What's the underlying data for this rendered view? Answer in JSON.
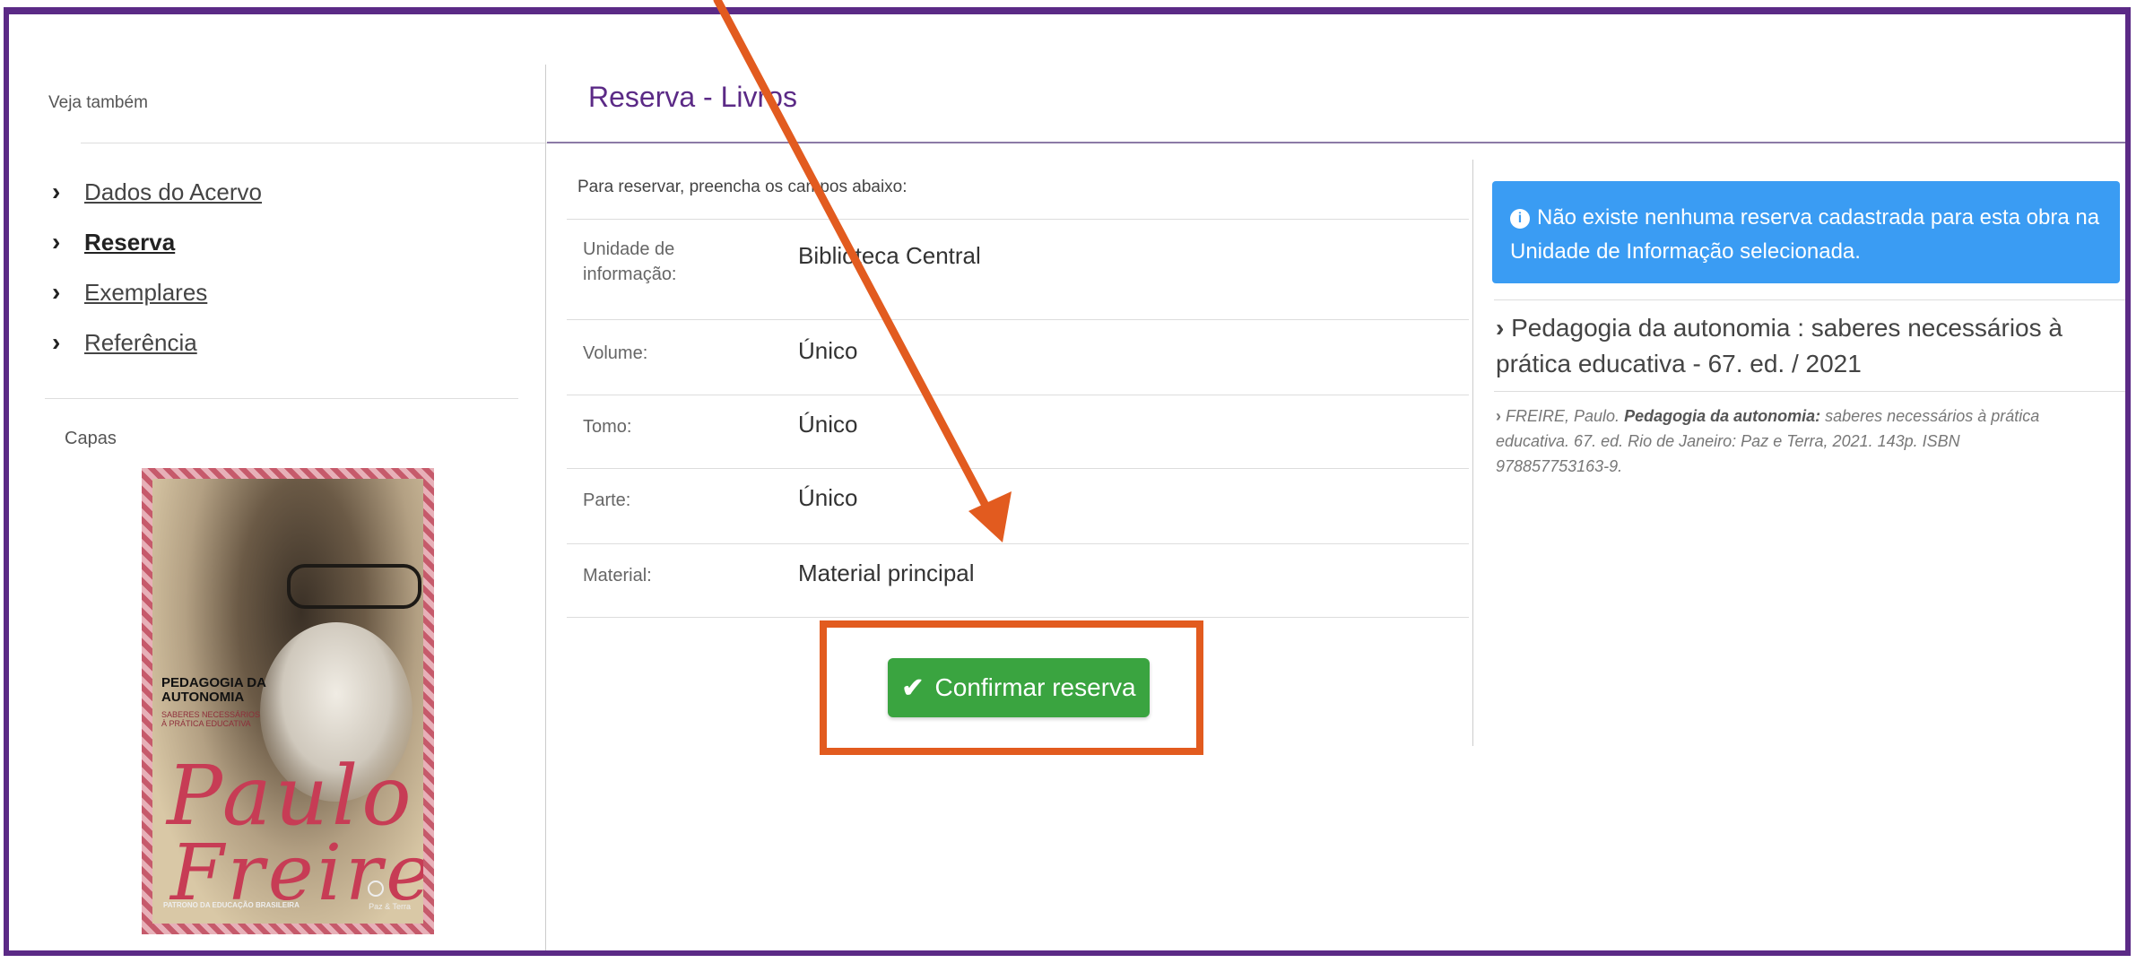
{
  "sidebar": {
    "veja_title": "Veja também",
    "items": [
      {
        "label": "Dados do Acervo",
        "active": false
      },
      {
        "label": "Reserva",
        "active": true
      },
      {
        "label": "Exemplares",
        "active": false
      },
      {
        "label": "Referência",
        "active": false
      }
    ],
    "capas_title": "Capas",
    "cover": {
      "title_line1": "PEDAGOGIA DA",
      "title_line2": "AUTONOMIA",
      "subtitle_line1": "SABERES NECESSÁRIOS",
      "subtitle_line2": "À PRÁTICA EDUCATIVA",
      "signature_line1": "Paulo",
      "signature_line2": "Freire",
      "footer": "PATRONO DA EDUCAÇÃO BRASILEIRA",
      "publisher": "Paz & Terra"
    }
  },
  "main": {
    "title": "Reserva - Livros",
    "instructions": "Para reservar, preencha os campos abaixo:",
    "fields": [
      {
        "label_line1": "Unidade de",
        "label_line2": "informação:",
        "value": "Biblioteca Central"
      },
      {
        "label": "Volume:",
        "value": "Único"
      },
      {
        "label": "Tomo:",
        "value": "Único"
      },
      {
        "label": "Parte:",
        "value": "Único"
      },
      {
        "label": "Material:",
        "value": "Material principal"
      }
    ],
    "confirm_label": "Confirmar reserva"
  },
  "info": {
    "alert": "Não existe nenhuma reserva cadastrada para esta obra na Unidade de Informação selecionada.",
    "book_title": "Pedagogia da autonomia : saberes necessários à prática educativa - 67. ed. / 2021",
    "reference": {
      "prefix": "FREIRE, Paulo.",
      "bold": "Pedagogia da autonomia:",
      "rest": "saberes necessários à prática educativa. 67. ed. Rio de Janeiro: Paz e Terra, 2021. 143p. ISBN 978857753163-9."
    }
  },
  "colors": {
    "frame": "#5b2a86",
    "title": "#5b2a86",
    "alert": "#3a9cf3",
    "confirm": "#3aa440",
    "annotation": "#e25b1f"
  }
}
